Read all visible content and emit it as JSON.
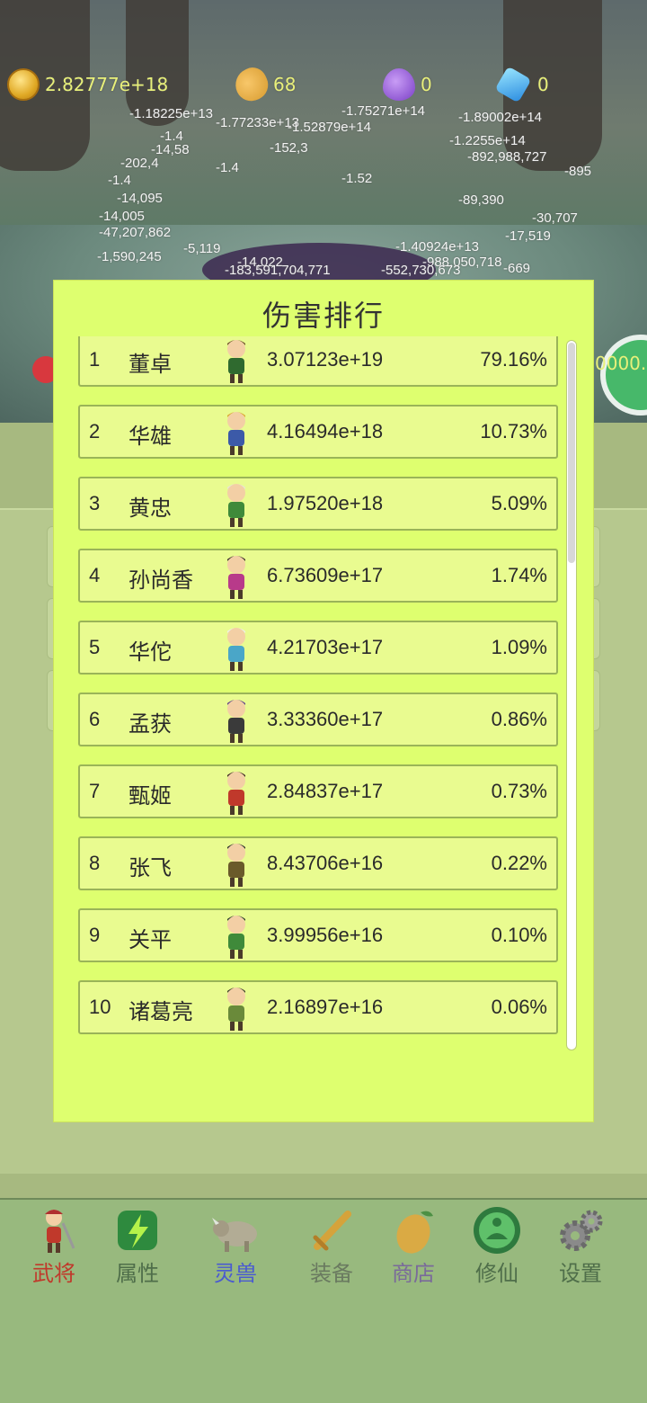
{
  "resources": {
    "gold": "2.82777e+18",
    "mango": "68",
    "potion": "0",
    "gem": "0"
  },
  "floating_damage": [
    "-1.18225e+13",
    "-1.77233e+13",
    "-1.75271e+14",
    "-1.52879e+14",
    "-1.89002e+14",
    "-1.4",
    "-14,58",
    "-152,3",
    "-1.2255e+14",
    "-202,4",
    "-1.4",
    "-892,988,727",
    "-1.4",
    "-1.52",
    "-895",
    "-14,095",
    "-89,390",
    "-14,005",
    "-30,707",
    "-47,207,862",
    "-1,590,245",
    "-5,119",
    "-1.40924e+13",
    "-17,519",
    "-14,022",
    "-988,050,718",
    "-183,591,704,771",
    "-552,730,673",
    "-669"
  ],
  "side": {
    "counter": "0000."
  },
  "modal": {
    "title": "伤害排行",
    "rows": [
      {
        "rank": "1",
        "name": "董卓",
        "damage": "3.07123e+19",
        "percent": "79.16%",
        "avatar": "dongzhuo-avatar"
      },
      {
        "rank": "2",
        "name": "华雄",
        "damage": "4.16494e+18",
        "percent": "10.73%",
        "avatar": "huaxiong-avatar"
      },
      {
        "rank": "3",
        "name": "黄忠",
        "damage": "1.97520e+18",
        "percent": "5.09%",
        "avatar": "huangzhong-avatar"
      },
      {
        "rank": "4",
        "name": "孙尚香",
        "damage": "6.73609e+17",
        "percent": "1.74%",
        "avatar": "sunshangxiang-avatar"
      },
      {
        "rank": "5",
        "name": "华佗",
        "damage": "4.21703e+17",
        "percent": "1.09%",
        "avatar": "huatuo-avatar"
      },
      {
        "rank": "6",
        "name": "孟获",
        "damage": "3.33360e+17",
        "percent": "0.86%",
        "avatar": "menghuo-avatar"
      },
      {
        "rank": "7",
        "name": "甄姬",
        "damage": "2.84837e+17",
        "percent": "0.73%",
        "avatar": "zhenji-avatar"
      },
      {
        "rank": "8",
        "name": "张飞",
        "damage": "8.43706e+16",
        "percent": "0.22%",
        "avatar": "zhangfei-avatar"
      },
      {
        "rank": "9",
        "name": "关平",
        "damage": "3.99956e+16",
        "percent": "0.10%",
        "avatar": "guanping-avatar"
      },
      {
        "rank": "10",
        "name": "诸葛亮",
        "damage": "2.16897e+16",
        "percent": "0.06%",
        "avatar": "zhugeliang-avatar"
      }
    ]
  },
  "tabs": [
    {
      "label": "武将",
      "color": "#c0392b",
      "icon": "warrior-icon"
    },
    {
      "label": "属性",
      "color": "#4f6e4a",
      "icon": "lightning-icon"
    },
    {
      "label": "灵兽",
      "color": "#4a5bd0",
      "icon": "beast-icon"
    },
    {
      "label": "装备",
      "color": "#6a7a60",
      "icon": "sword-icon"
    },
    {
      "label": "商店",
      "color": "#7a6a9a",
      "icon": "mango-icon"
    },
    {
      "label": "修仙",
      "color": "#4f6e4a",
      "icon": "meditation-icon"
    },
    {
      "label": "设置",
      "color": "#4f6e4a",
      "icon": "gear-icon"
    }
  ]
}
